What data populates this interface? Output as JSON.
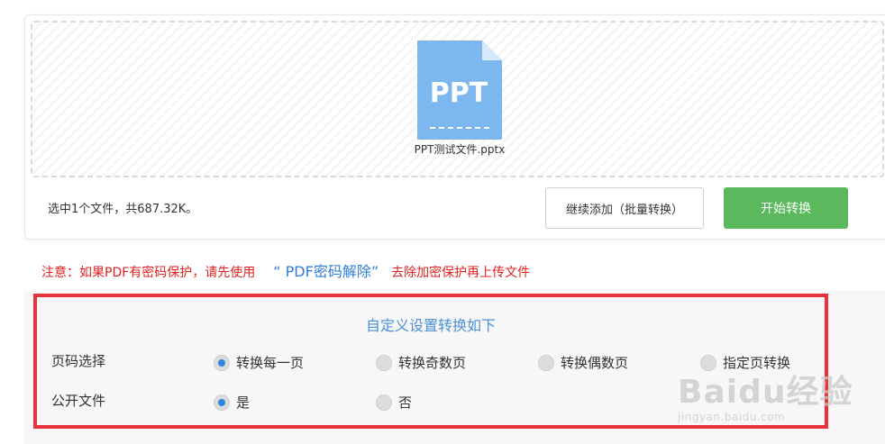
{
  "file": {
    "type_label": "PPT",
    "name": "PPT测试文件.pptx",
    "icon": "ppt-file-icon",
    "color": "#7db7ef"
  },
  "status": "选中1个文件，共687.32K。",
  "buttons": {
    "add_more": "继续添加（批量转换）",
    "start": "开始转换",
    "start_color": "#5cb85c"
  },
  "notice": {
    "prefix": "注意：如果PDF有密码保护，请先使用",
    "link": "“ PDF密码解除”",
    "suffix": "去除加密保护再上传文件"
  },
  "settings": {
    "title": "自定义设置转换如下",
    "page_select": {
      "label": "页码选择",
      "options": [
        "转换每一页",
        "转换奇数页",
        "转换偶数页",
        "指定页转换"
      ],
      "selected": "转换每一页"
    },
    "public_file": {
      "label": "公开文件",
      "options": [
        "是",
        "否"
      ],
      "selected": "是"
    }
  },
  "watermark": {
    "logo": "Baidu经验",
    "url": "jingyan.baidu.com"
  },
  "colors": {
    "highlight_border": "#e8323c",
    "accent": "#4a90d9",
    "radio_checked": "#2e86de"
  }
}
